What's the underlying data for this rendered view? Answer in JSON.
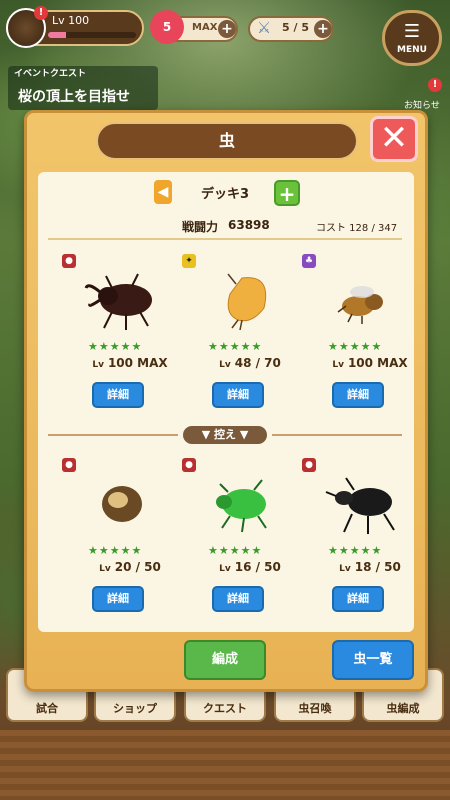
{
  "hud": {
    "level_label": "Lv 100",
    "alert_badge": "!",
    "heart_count": "5",
    "heart_status": "MAX",
    "battle_count": "5 / 5",
    "plus": "+",
    "menu_label": "MENU",
    "level_progress": 0.2
  },
  "event": {
    "small_label": "イベントクエスト",
    "title": "桜の頂上を目指せ"
  },
  "notice": {
    "label": "お知らせ",
    "alert": "!"
  },
  "bottom_nav": [
    {
      "label": "試合"
    },
    {
      "label": "ショップ"
    },
    {
      "label": "クエスト"
    },
    {
      "label": "虫召喚"
    },
    {
      "label": "虫編成"
    }
  ],
  "modal": {
    "title": "虫",
    "close": "✕",
    "deck_name": "デッキ3",
    "deck_prev": "◀",
    "deck_add": "+",
    "power_label": "戦闘力",
    "power_value": "63898",
    "cost_label": "コスト 128 / 347",
    "reserve_label": "▼ 控え ▼",
    "form_button": "編成",
    "list_button": "虫一覧"
  },
  "active_bugs": [
    {
      "type": "ladybug",
      "stars": "★★★★★",
      "lv_prefix": "Lv",
      "level": "100 MAX",
      "detail": "詳細"
    },
    {
      "type": "butterfly",
      "stars": "★★★★★",
      "lv_prefix": "Lv",
      "level": "48 / 70",
      "detail": "詳細"
    },
    {
      "type": "bee",
      "stars": "★★★★★",
      "lv_prefix": "Lv",
      "level": "100 MAX",
      "detail": "詳細"
    }
  ],
  "reserve_bugs": [
    {
      "type": "ladybug",
      "stars": "★★★★★",
      "lv_prefix": "Lv",
      "level": "20 / 50",
      "detail": "詳細"
    },
    {
      "type": "ladybug",
      "stars": "★★★★★",
      "lv_prefix": "Lv",
      "level": "16 / 50",
      "detail": "詳細"
    },
    {
      "type": "ladybug",
      "stars": "★★★★★",
      "lv_prefix": "Lv",
      "level": "18 / 50",
      "detail": "詳細"
    }
  ],
  "colors": {
    "modal_bg": "#f2c56a",
    "primary_button": "#2a8ae0",
    "confirm_button": "#5ab84a",
    "close_button": "#ee5a5a",
    "star_color": "#3a9a2a"
  }
}
